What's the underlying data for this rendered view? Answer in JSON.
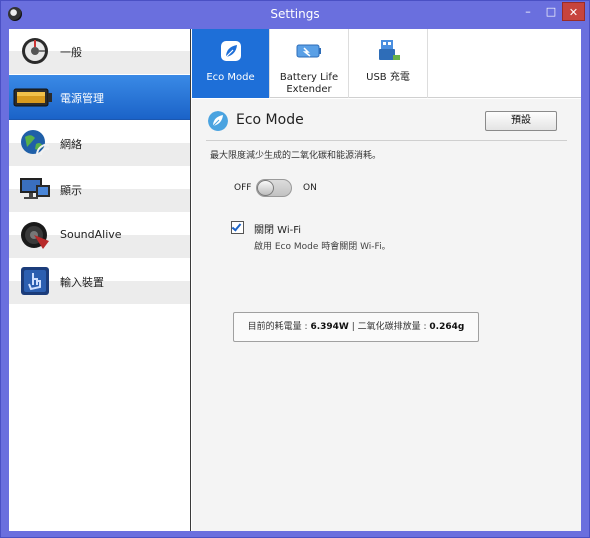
{
  "window": {
    "title": "Settings",
    "minimize": "–",
    "maximize": "□",
    "close": "✕"
  },
  "sidebar": {
    "items": [
      {
        "label": "一般",
        "icon": "general-gear-icon"
      },
      {
        "label": "電源管理",
        "icon": "battery-icon"
      },
      {
        "label": "網絡",
        "icon": "network-globe-icon"
      },
      {
        "label": "顯示",
        "icon": "display-monitor-icon"
      },
      {
        "label": "SoundAlive",
        "icon": "speaker-icon"
      },
      {
        "label": "輸入裝置",
        "icon": "touch-input-icon"
      }
    ],
    "active_index": 1
  },
  "tabs": [
    {
      "label": "Eco Mode",
      "icon": "leaf-icon"
    },
    {
      "label": "Battery Life\nExtender",
      "icon": "battery-extender-icon"
    },
    {
      "label": "USB 充電",
      "icon": "usb-charge-icon"
    }
  ],
  "eco": {
    "title": "Eco Mode",
    "default_button": "預設",
    "description": "最大限度減少生成的二氧化碳和能源消耗。",
    "toggle_off": "OFF",
    "toggle_on": "ON",
    "toggle_state": "off",
    "wifi_label": "關閉 Wi-Fi",
    "wifi_checked": true,
    "wifi_sub": "啟用 Eco Mode 時會關閉 Wi-Fi。"
  },
  "stats": {
    "consumption_label": "目前的耗電量 :",
    "consumption_value": "6.394W",
    "separator": "|",
    "co2_label": "二氧化碳排放量 :",
    "co2_value": "0.264g"
  },
  "colors": {
    "accent": "#1e6fd8",
    "frame": "#6a6fde",
    "close": "#c7443d"
  }
}
